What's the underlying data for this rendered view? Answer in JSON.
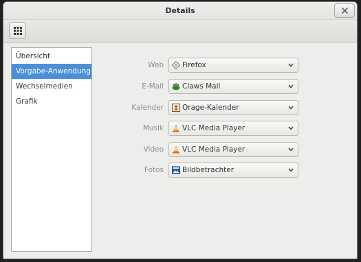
{
  "window": {
    "title": "Details"
  },
  "sidebar": {
    "items": [
      {
        "label": "Übersicht"
      },
      {
        "label": "Vorgabe-Anwendung..."
      },
      {
        "label": "Wechselmedien"
      },
      {
        "label": "Grafik"
      }
    ],
    "selected_index": 1
  },
  "defaults": {
    "rows": [
      {
        "label": "Web",
        "value": "Firefox",
        "icon": "firefox-icon"
      },
      {
        "label": "E-Mail",
        "value": "Claws Mail",
        "icon": "claws-mail-icon"
      },
      {
        "label": "Kalender",
        "value": "Orage-Kalender",
        "icon": "orage-calendar-icon"
      },
      {
        "label": "Musik",
        "value": "VLC Media Player",
        "icon": "vlc-icon"
      },
      {
        "label": "Video",
        "value": "VLC Media Player",
        "icon": "vlc-icon"
      },
      {
        "label": "Fotos",
        "value": "Bildbetrachter",
        "icon": "image-viewer-icon"
      }
    ]
  },
  "colors": {
    "selection": "#4a90d9",
    "window_bg": "#ededeb"
  }
}
